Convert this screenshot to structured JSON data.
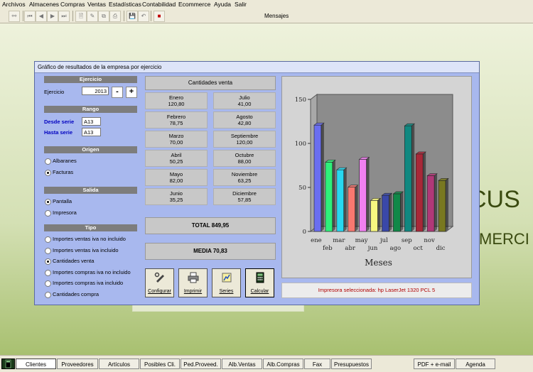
{
  "menu": [
    "Archivos",
    "Almacenes",
    "Compras",
    "Ventas",
    "Estadísticas",
    "Contabilidad",
    "Ecommerce",
    "Ayuda",
    "Salir"
  ],
  "toolbar": {
    "mensajes": "Mensajes"
  },
  "background": {
    "text1": "CUS",
    "text2": "MERCI"
  },
  "window": {
    "title": "Gráfico de resultados de la empresa por ejercicio",
    "ejercicio": {
      "header": "Ejercicio",
      "label": "Ejercicio",
      "value": "2013",
      "minus": "-",
      "plus": "+"
    },
    "rango": {
      "header": "Rango",
      "desde_label": "Desde serie",
      "desde_value": "A13",
      "hasta_label": "Hasta serie",
      "hasta_value": "A13"
    },
    "origen": {
      "header": "Origen",
      "options": [
        "Albaranes",
        "Facturas"
      ],
      "selected": "Facturas"
    },
    "salida": {
      "header": "Salida",
      "options": [
        "Pantalla",
        "Impresora"
      ],
      "selected": "Pantalla"
    },
    "tipo": {
      "header": "Tipo",
      "options": [
        "Importes ventas iva no incluido",
        "Importes ventas iva incluido",
        "Cantidades venta",
        "Importes compras iva no incluido",
        "Importes compras iva incluido",
        "Cantidades compra"
      ],
      "selected": "Cantidades venta"
    },
    "cantidades": {
      "header": "Cantidades venta",
      "months": [
        {
          "name": "Enero",
          "value": "120,80"
        },
        {
          "name": "Julio",
          "value": "41,00"
        },
        {
          "name": "Febrero",
          "value": "78,75"
        },
        {
          "name": "Agosto",
          "value": "42,80"
        },
        {
          "name": "Marzo",
          "value": "70,00"
        },
        {
          "name": "Septiembre",
          "value": "120,00"
        },
        {
          "name": "Abril",
          "value": "50,25"
        },
        {
          "name": "Octubre",
          "value": "88,00"
        },
        {
          "name": "Mayo",
          "value": "82,00"
        },
        {
          "name": "Noviembre",
          "value": "63,25"
        },
        {
          "name": "Junio",
          "value": "35,25"
        },
        {
          "name": "Diciembre",
          "value": "57,85"
        }
      ],
      "total": "TOTAL 849,95",
      "media": "MEDIA 70,83"
    },
    "buttons": {
      "configurar": "Configurar",
      "imprimir": "Imprimir",
      "series": "Series",
      "calcular": "Calcular"
    },
    "printer": "Impresora seleccionada: hp LaserJet 1320 PCL 5"
  },
  "chart_data": {
    "type": "bar",
    "categories": [
      "ene",
      "feb",
      "mar",
      "abr",
      "may",
      "jun",
      "jul",
      "ago",
      "sep",
      "oct",
      "nov",
      "dic"
    ],
    "values": [
      120.8,
      78.75,
      70.0,
      50.25,
      82.0,
      35.25,
      41.0,
      42.8,
      120.0,
      88.0,
      63.25,
      57.85
    ],
    "colors": [
      "#6a6ef0",
      "#2ef07a",
      "#28d8f0",
      "#f87870",
      "#f080f0",
      "#f8f880",
      "#3a48a8",
      "#108848",
      "#108880",
      "#a82838",
      "#b03878",
      "#787820"
    ],
    "xlabel": "Meses",
    "ylabel": "",
    "ylim": [
      0,
      150
    ],
    "yticks": [
      0,
      50,
      100,
      150
    ],
    "grid": false,
    "legend": "none"
  },
  "taskbar": [
    "Clientes",
    "Proveedores",
    "Artículos",
    "Posibles Cli.",
    "Ped.Proveed.",
    "Alb.Ventas",
    "Alb.Compras",
    "Fax",
    "Presupuestos",
    "PDF + e-mail",
    "Agenda"
  ]
}
